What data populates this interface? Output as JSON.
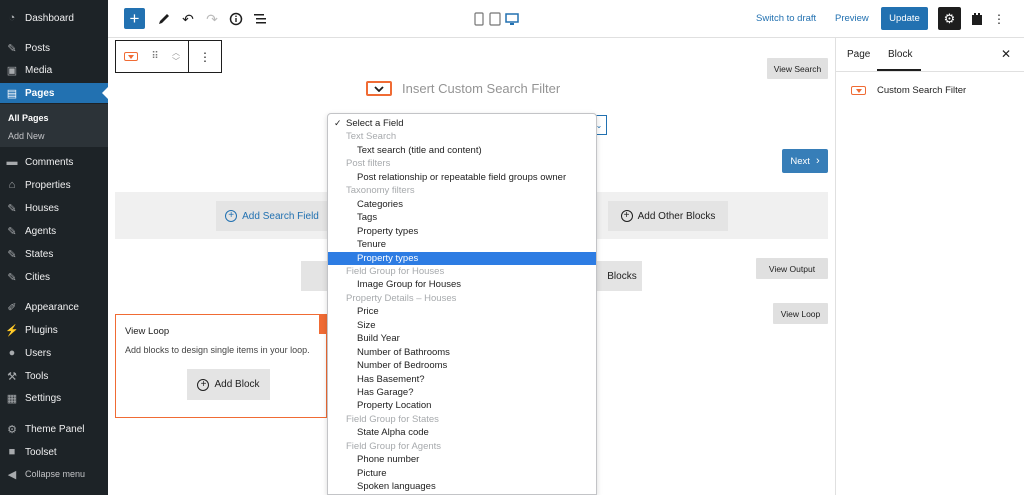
{
  "sidebar": {
    "items": [
      {
        "label": "Dashboard",
        "icon": "dashboard-icon"
      },
      {
        "label": "Posts",
        "icon": "pin-icon"
      },
      {
        "label": "Media",
        "icon": "media-icon"
      },
      {
        "label": "Pages",
        "icon": "page-icon"
      },
      {
        "label": "Comments",
        "icon": "comment-icon"
      },
      {
        "label": "Properties",
        "icon": "home-icon"
      },
      {
        "label": "Houses",
        "icon": "pin-icon"
      },
      {
        "label": "Agents",
        "icon": "pin-icon"
      },
      {
        "label": "States",
        "icon": "pin-icon"
      },
      {
        "label": "Cities",
        "icon": "pin-icon"
      },
      {
        "label": "Appearance",
        "icon": "brush-icon"
      },
      {
        "label": "Plugins",
        "icon": "plug-icon"
      },
      {
        "label": "Users",
        "icon": "user-icon"
      },
      {
        "label": "Tools",
        "icon": "wrench-icon"
      },
      {
        "label": "Settings",
        "icon": "settings-icon"
      },
      {
        "label": "Theme Panel",
        "icon": "gear-icon"
      },
      {
        "label": "Toolset",
        "icon": "toolset-icon"
      },
      {
        "label": "Collapse menu",
        "icon": "collapse-icon"
      }
    ],
    "submenu": {
      "all_pages": "All Pages",
      "add_new": "Add New"
    }
  },
  "topbar": {
    "switch_to_draft": "Switch to draft",
    "preview": "Preview",
    "update": "Update"
  },
  "editor": {
    "block_title": "Insert Custom Search Filter",
    "view_search": "View Search",
    "next": "Next",
    "add_search_field": "Add Search Field",
    "add_other_blocks": "Add Other Blocks",
    "blocks_partial": "Blocks",
    "view_output": "View Output",
    "view_loop_btn": "View Loop",
    "view_loop_title": "View Loop",
    "view_loop_desc": "Add blocks to design single items in your loop.",
    "add_block": "Add Block"
  },
  "panel": {
    "tab_page": "Page",
    "tab_block": "Block",
    "block_name": "Custom Search Filter"
  },
  "dropdown": {
    "items": [
      {
        "label": "Select a Field",
        "kind": "first"
      },
      {
        "label": "Text Search",
        "kind": "group"
      },
      {
        "label": "Text search (title and content)",
        "kind": "option"
      },
      {
        "label": "Post filters",
        "kind": "group"
      },
      {
        "label": "Post relationship or repeatable field groups owner",
        "kind": "option"
      },
      {
        "label": "Taxonomy filters",
        "kind": "group"
      },
      {
        "label": "Categories",
        "kind": "option"
      },
      {
        "label": "Tags",
        "kind": "option"
      },
      {
        "label": "Property types",
        "kind": "option"
      },
      {
        "label": "Tenure",
        "kind": "option"
      },
      {
        "label": "Property types",
        "kind": "highlight"
      },
      {
        "label": "Field Group for Houses",
        "kind": "group"
      },
      {
        "label": "Image Group for Houses",
        "kind": "option"
      },
      {
        "label": "Property Details – Houses",
        "kind": "group"
      },
      {
        "label": "Price",
        "kind": "option"
      },
      {
        "label": "Size",
        "kind": "option"
      },
      {
        "label": "Build Year",
        "kind": "option"
      },
      {
        "label": "Number of Bathrooms",
        "kind": "option"
      },
      {
        "label": "Number of Bedrooms",
        "kind": "option"
      },
      {
        "label": "Has Basement?",
        "kind": "option"
      },
      {
        "label": "Has Garage?",
        "kind": "option"
      },
      {
        "label": "Property Location",
        "kind": "option"
      },
      {
        "label": "Field Group for States",
        "kind": "group"
      },
      {
        "label": "State Alpha code",
        "kind": "option"
      },
      {
        "label": "Field Group for Agents",
        "kind": "group"
      },
      {
        "label": "Phone number",
        "kind": "option"
      },
      {
        "label": "Picture",
        "kind": "option"
      },
      {
        "label": "Spoken languages",
        "kind": "option"
      }
    ]
  },
  "colors": {
    "accent": "#2271b1",
    "sidebar_bg": "#1d2327",
    "highlight": "#2d7ce3",
    "block_orange": "#f06b34"
  }
}
